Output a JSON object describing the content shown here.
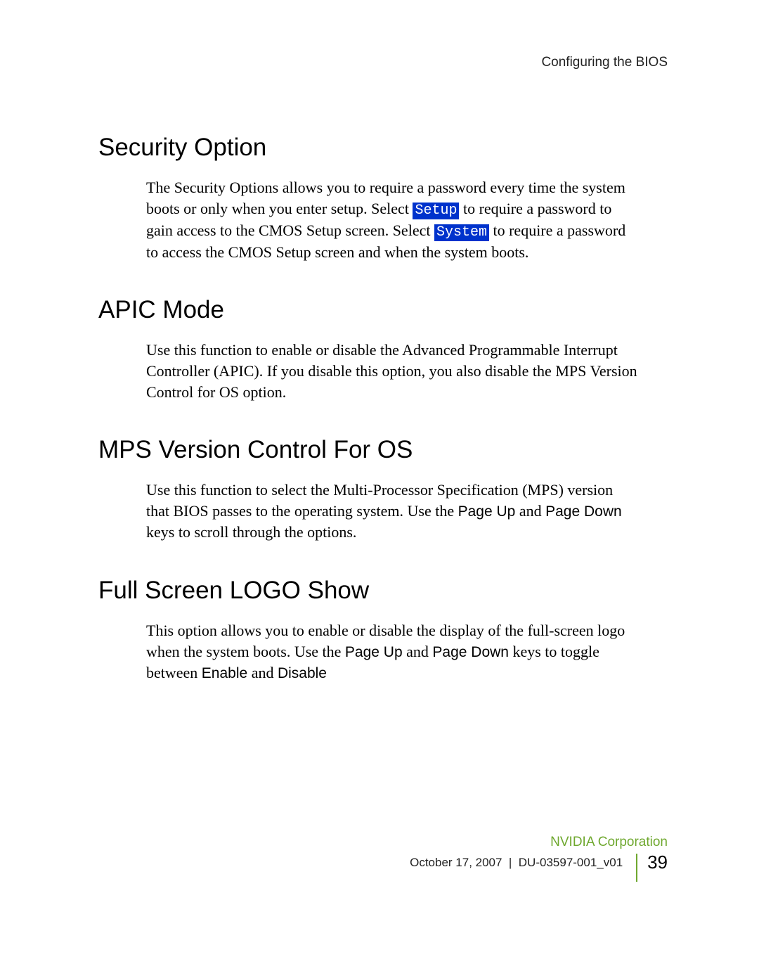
{
  "header": {
    "title": "Configuring the BIOS"
  },
  "sections": {
    "security": {
      "heading": "Security Option",
      "p1a": "The Security Options allows you to require a password every time the system boots or only when you enter setup. Select ",
      "hl1": "Setup",
      "p1b": " to require a password to gain access to the CMOS Setup screen.  Select ",
      "hl2": "System",
      "p1c": " to require a password to access the CMOS Setup screen and when the system boots."
    },
    "apic": {
      "heading": "APIC Mode",
      "p1": "Use this function to enable or disable the Advanced Programmable Interrupt Controller (APIC). If you disable this option, you also disable the MPS Version Control for OS option."
    },
    "mps": {
      "heading": "MPS Version Control For OS",
      "p1a": "Use this function to select the Multi-Processor Specification (MPS) version that BIOS passes to the operating system. Use the ",
      "k1": "Page Up",
      "p1b": " and ",
      "k2": "Page Down",
      "p1c": " keys to scroll through the options."
    },
    "logo": {
      "heading": "Full Screen LOGO Show",
      "p1a": "This option allows you to enable or disable the display of the full-screen logo when the system boots. Use the ",
      "k1": "Page Up",
      "p1b": " and ",
      "k2": "Page Down",
      "p1c": " keys to toggle between ",
      "k3": "Enable",
      "p1d": " and ",
      "k4": "Disable"
    }
  },
  "footer": {
    "corp": "NVIDIA Corporation",
    "date": "October 17, 2007",
    "doc": "DU-03597-001_v01",
    "page": "39"
  }
}
